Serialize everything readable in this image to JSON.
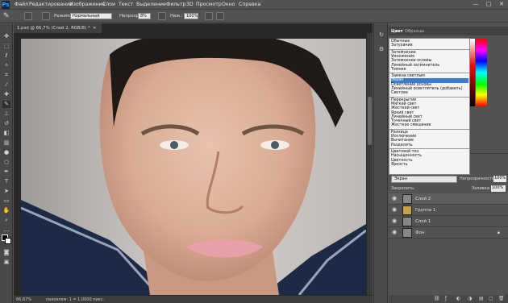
{
  "app": {
    "logo": "Ps"
  },
  "menu": [
    "Файл",
    "Редактирование",
    "Изображение",
    "Слои",
    "Текст",
    "Выделение",
    "Фильтр",
    "3D",
    "Просмотр",
    "Окно",
    "Справка"
  ],
  "window_controls": [
    "—",
    "□",
    "✕"
  ],
  "options": {
    "mode_label": "Режим:",
    "mode_value": "Нормальный",
    "opacity_label": "Непрозр.:",
    "opacity_value": "8%",
    "flow_label": "Наж.:",
    "flow_value": "100%"
  },
  "document_tab": {
    "title": "1.psd @ 66,7% (Слой 2, RGB/8) *",
    "close": "×"
  },
  "status": {
    "zoom": "66,67%",
    "info": "пикселям: 1 = 1,0000 пикс."
  },
  "color_panel": {
    "tabs": [
      "Цвет",
      "Образцы"
    ]
  },
  "blend_modes": {
    "groups": [
      [
        "Обычные",
        "Затухание"
      ],
      [
        "Затемнение",
        "Умножение",
        "Затемнение основы",
        "Линейный затемнитель",
        "Темнее"
      ],
      [
        "Замена светлым",
        "Экран",
        "Осветление основы",
        "Линейный осветлитель (добавить)",
        "Светлее"
      ],
      [
        "Перекрытие",
        "Мягкий свет",
        "Жесткий свет",
        "Яркий свет",
        "Линейный свет",
        "Точечный свет",
        "Жесткое смешение"
      ],
      [
        "Разница",
        "Исключение",
        "Вычитание",
        "Разделить"
      ],
      [
        "Цветовой тон",
        "Насыщенность",
        "Цветность",
        "Яркость"
      ]
    ],
    "selected": "Экран"
  },
  "layers_panel": {
    "blend_value": "Экран",
    "opacity_label": "Непрозрачность:",
    "opacity_value": "100%",
    "lock_label": "Закрепить:",
    "fill_label": "Заливка:",
    "fill_value": "100%",
    "layers": [
      {
        "name": "Слой 2",
        "selected": true
      },
      {
        "name": "Группа 1",
        "selected": false
      },
      {
        "name": "Слой 1",
        "selected": false
      },
      {
        "name": "Фон",
        "selected": false
      }
    ]
  }
}
